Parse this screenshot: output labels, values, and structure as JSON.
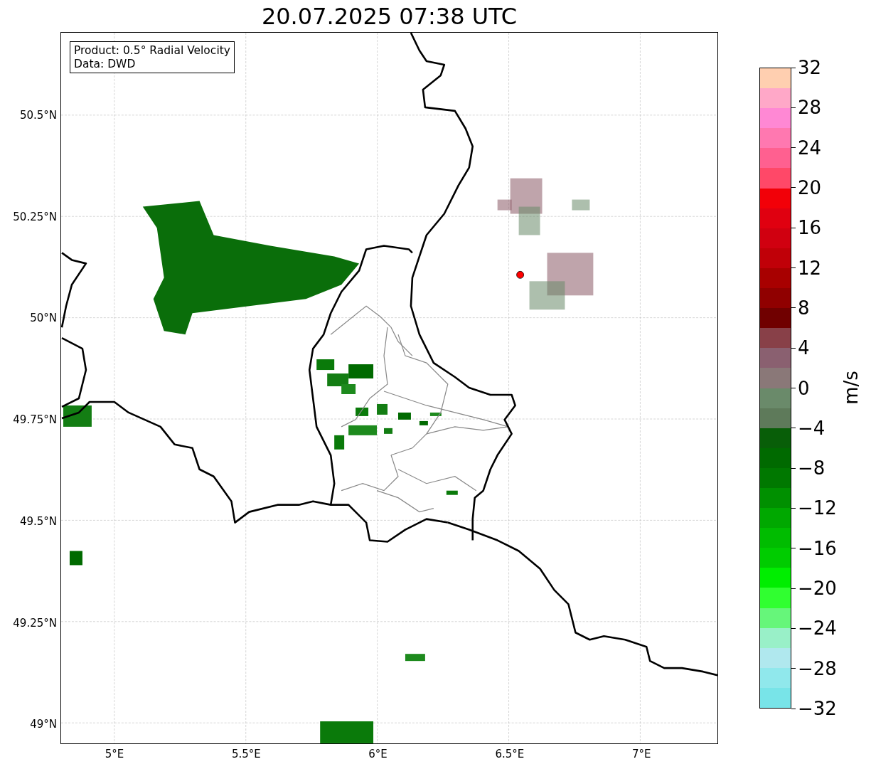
{
  "title": "20.07.2025 07:38 UTC",
  "info_box": [
    "Product: 0.5° Radial Velocity",
    "Data: DWD"
  ],
  "lat_labels": [
    "50.5°N",
    "50.25°N",
    "50°N",
    "49.75°N",
    "49.5°N",
    "49.25°N",
    "49°N"
  ],
  "lon_labels": [
    "5°E",
    "5.5°E",
    "6°E",
    "6.5°E",
    "7°E"
  ],
  "colorbar": {
    "label": "m/s",
    "ticks": [
      "32",
      "28",
      "24",
      "20",
      "16",
      "12",
      "8",
      "4",
      "0",
      "−4",
      "−8",
      "−12",
      "−16",
      "−20",
      "−24",
      "−28",
      "−32"
    ],
    "segments": [
      {
        "color": "#ffcfb0"
      },
      {
        "color": "#ffa8c8"
      },
      {
        "color": "#ff88d4"
      },
      {
        "color": "#ff78b0"
      },
      {
        "color": "#ff6090"
      },
      {
        "color": "#ff4868"
      },
      {
        "color": "#f20008"
      },
      {
        "color": "#e00010"
      },
      {
        "color": "#d00010"
      },
      {
        "color": "#c00008"
      },
      {
        "color": "#a80000"
      },
      {
        "color": "#900000"
      },
      {
        "color": "#700000"
      },
      {
        "color": "#884048"
      },
      {
        "color": "#8a6070"
      },
      {
        "color": "#8a7878"
      },
      {
        "color": "#6a8a6a"
      },
      {
        "color": "#5e7a5a"
      },
      {
        "color": "#085e08"
      },
      {
        "color": "#006a00"
      },
      {
        "color": "#007800"
      },
      {
        "color": "#009000"
      },
      {
        "color": "#00a800"
      },
      {
        "color": "#00bc00"
      },
      {
        "color": "#00cc00"
      },
      {
        "color": "#00ee00"
      },
      {
        "color": "#30ff30"
      },
      {
        "color": "#66f67a"
      },
      {
        "color": "#99f0c8"
      },
      {
        "color": "#b0e8ee"
      },
      {
        "color": "#90e8ec"
      },
      {
        "color": "#78e4e8"
      }
    ]
  }
}
